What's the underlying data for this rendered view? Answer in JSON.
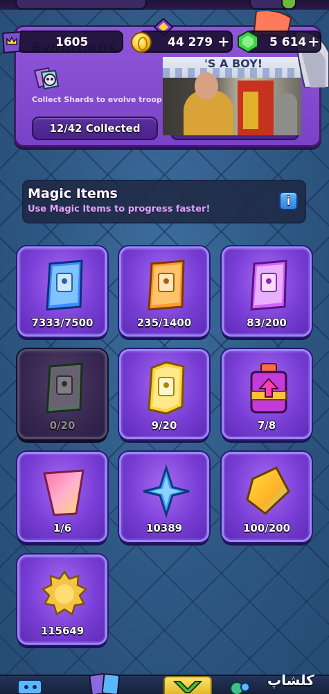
{
  "resources": {
    "trophies": "1605",
    "gold": "44 279",
    "gems": "5 614",
    "plus": "+"
  },
  "evolutions": {
    "title": "Evolutions",
    "description": "Collect Shards to evolve troop",
    "collected_label": "12/42 Collected"
  },
  "video_overlay": {
    "banner_text": "'S A BOY!"
  },
  "magic_items": {
    "title": "Magic Items",
    "subtitle": "Use Magic Items to progress faster!",
    "info_label": "i",
    "items": [
      {
        "name": "common-wild-card",
        "count": "7333/7500",
        "color": "#3f8cff"
      },
      {
        "name": "rare-wild-card",
        "count": "235/1400",
        "color": "#ff9a2e"
      },
      {
        "name": "epic-wild-card",
        "count": "83/200",
        "color": "#d166ff"
      },
      {
        "name": "legendary-wild-card",
        "count": "0/20",
        "color": "#7fd9a0"
      },
      {
        "name": "champion-wild-card",
        "count": "9/20",
        "color": "#ffd23a"
      },
      {
        "name": "elixir-bottle",
        "count": "7/8",
        "color": "#c43bd9"
      },
      {
        "name": "evolution-shard",
        "count": "1/6",
        "color": "#ff7ab0"
      },
      {
        "name": "star-point",
        "count": "10389",
        "color": "#3aa0ff"
      },
      {
        "name": "gem-crystal",
        "count": "100/200",
        "color": "#ffcf3a"
      },
      {
        "name": "gold-star-badge",
        "count": "115649",
        "color": "#f4c542"
      }
    ]
  },
  "watermark": "کلشاپ"
}
